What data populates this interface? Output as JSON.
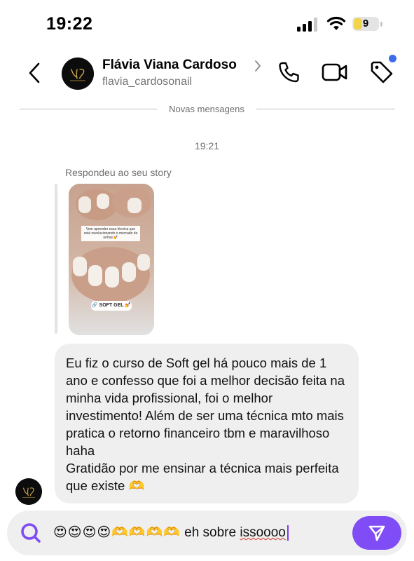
{
  "status_bar": {
    "time": "19:22",
    "battery_level": "9",
    "battery_color": "#f2d44a"
  },
  "header": {
    "back_icon": "chevron-left-icon",
    "contact_name": "Flávia Viana Cardoso",
    "contact_handle": "flavia_cardosonail",
    "actions": [
      "phone-icon",
      "video-camera-icon",
      "tag-icon"
    ],
    "notification_dot_color": "#3b6ee8"
  },
  "conversation": {
    "divider_label": "Novas mensagens",
    "timestamp": "19:21",
    "reply_label": "Respondeu ao seu story",
    "story": {
      "caption": "Vem aprender essa técnica que está revolucionando o mercado de unhas 💅",
      "sticker": "🔗 SOFT GEL 💅"
    },
    "message": "Eu fiz o curso de Soft gel há pouco mais de 1 ano e confesso que foi a melhor decisão feita na minha vida profissional, foi o melhor investimento! Além de ser uma técnica mto mais pratica o retorno financeiro tbm e maravilhoso haha\nGratidão por me ensinar a técnica mais perfeita que existe 🫶"
  },
  "composer": {
    "search_icon": "search-icon",
    "input_emojis": "😍😍😍😍🫶🫶🫶🫶",
    "input_text_plain": " eh sobre ",
    "input_text_misspelled": "issoooo",
    "send_icon": "send-icon",
    "accent_color": "#7f4cf5"
  }
}
